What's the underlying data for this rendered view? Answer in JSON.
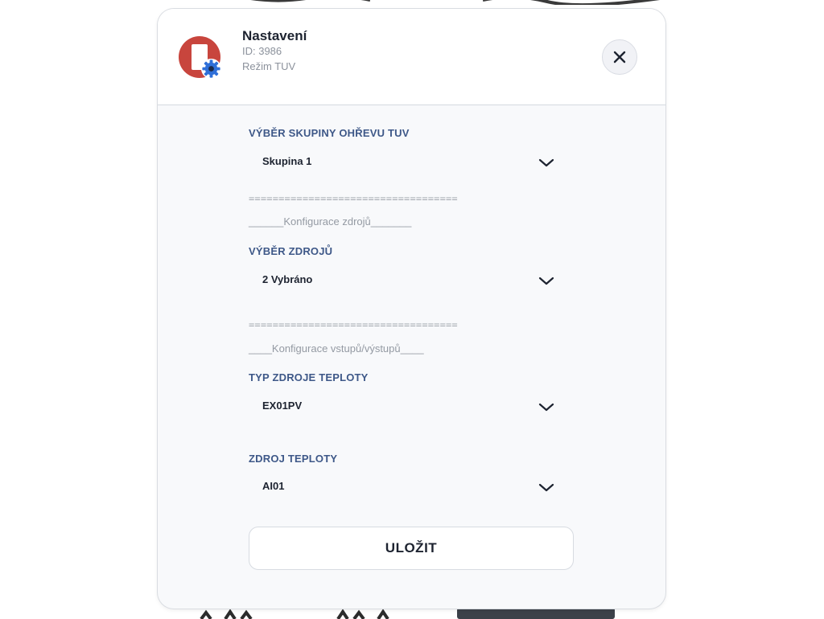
{
  "header": {
    "title": "Nastavení",
    "id_line": "ID: 3986",
    "mode_line": "Režim TUV",
    "avatar_color": "#c8453d",
    "badge_color": "#2f6fd8",
    "close_icon": "close-icon"
  },
  "fields": [
    {
      "label": "VÝBĚR SKUPINY OHŘEVU TUV",
      "value": "Skupina 1"
    },
    {
      "label": "VÝBĚR ZDROJŮ",
      "value": "2 Vybráno"
    },
    {
      "label": "TYP ZDROJE TEPLOTY",
      "value": "EX01PV"
    },
    {
      "label": "ZDROJ TEPLOTY",
      "value": "AI01"
    }
  ],
  "sections": [
    {
      "separator": "===================================",
      "caption": "______Konfigurace zdrojů_______"
    },
    {
      "separator": "===================================",
      "caption": "____Konfigurace vstupů/výstupů____"
    }
  ],
  "actions": {
    "save_label": "ULOŽIT"
  },
  "colors": {
    "label": "#3e5888",
    "text": "#1d2330",
    "muted": "#8c929c",
    "panel": "#f8f9fb"
  }
}
